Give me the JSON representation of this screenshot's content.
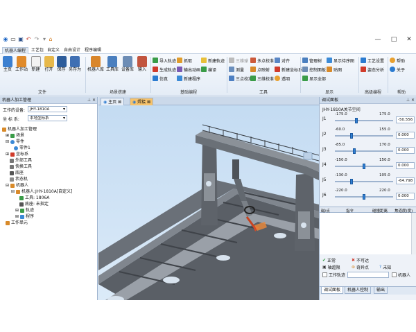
{
  "titlebar": {
    "minimize": "—",
    "maximize": "□",
    "close": "✕"
  },
  "menu": {
    "tabs": [
      "机器人编程",
      "工艺包",
      "自定义",
      "自由设计",
      "程序编辑"
    ]
  },
  "ribbon": {
    "file": {
      "group": "文件",
      "buttons": [
        "主页",
        "工作站",
        "新建",
        "打开",
        "保存",
        "另存为"
      ]
    },
    "scene": {
      "group": "场景搭建",
      "buttons": [
        "机器人库",
        "工具库",
        "设备库",
        "输入"
      ]
    },
    "program": {
      "group": "基础编程",
      "rows": [
        "导入轨迹",
        "生成轨迹",
        "仿真",
        "抓取",
        "输出动画",
        "新建程序",
        "新建轨迹",
        "编译"
      ]
    },
    "tools": {
      "group": "工具",
      "rows": [
        "三维球",
        "测量",
        "三点校准",
        "多点校准",
        "点映射",
        "三维校准",
        "对齐",
        "新建坐标系",
        "透明"
      ]
    },
    "display": {
      "group": "显示",
      "rows": [
        "管理树",
        "控制面板",
        "显示全部",
        "显示待序图",
        "贴图"
      ]
    },
    "advanced": {
      "group": "高级编程",
      "rows": [
        "工艺设置",
        "姿态分析"
      ]
    },
    "help": {
      "group": "帮助",
      "rows": [
        "帮助",
        "关于"
      ]
    }
  },
  "left": {
    "title": "机器人加工管理",
    "device_label": "工作的设备:",
    "device_value": "JHY-1810A",
    "coord_label": "坐 标 系:",
    "coord_value": "本地坐标系",
    "tree": [
      "机器人加工管理",
      "场景",
      "零件",
      "零件1",
      "坐标系",
      "外部工具",
      "快换工具",
      "底座",
      "状态机",
      "机器人",
      "机器人:JHY-1810A[自定义]",
      "工具: 1806A",
      "底座: 未指定",
      "轨迹",
      "程序",
      "工作单元"
    ]
  },
  "viewport": {
    "tabs": [
      "主页",
      "焊接"
    ]
  },
  "right": {
    "title": "调试面板",
    "robot": "JHY-1810A关节空间",
    "joints": [
      {
        "name": "J1",
        "min": "-175.0",
        "max": "175.0",
        "value": "-50.556",
        "pos": 0.36
      },
      {
        "name": "J2",
        "min": "-60.0",
        "max": "155.0",
        "value": "0.000",
        "pos": 0.28
      },
      {
        "name": "J3",
        "min": "-85.0",
        "max": "170.0",
        "value": "0.000",
        "pos": 0.33
      },
      {
        "name": "J4",
        "min": "-150.0",
        "max": "150.0",
        "value": "0.000",
        "pos": 0.5
      },
      {
        "name": "J5",
        "min": "-130.0",
        "max": "105.0",
        "value": "-64.798",
        "pos": 0.27
      },
      {
        "name": "J6",
        "min": "-220.0",
        "max": "220.0",
        "value": "0.000",
        "pos": 0.5
      }
    ],
    "table_headers": [
      "磁/点",
      "指令",
      "碰撞距离",
      "焦道度(度)"
    ],
    "status": [
      "正常",
      "不可达",
      "轴超限",
      "奇异点",
      "未知"
    ],
    "work_track": "工作轨迹",
    "robot_check": "机器人",
    "bottom_tabs": [
      "调试面板",
      "机器人控制",
      "输出"
    ]
  }
}
